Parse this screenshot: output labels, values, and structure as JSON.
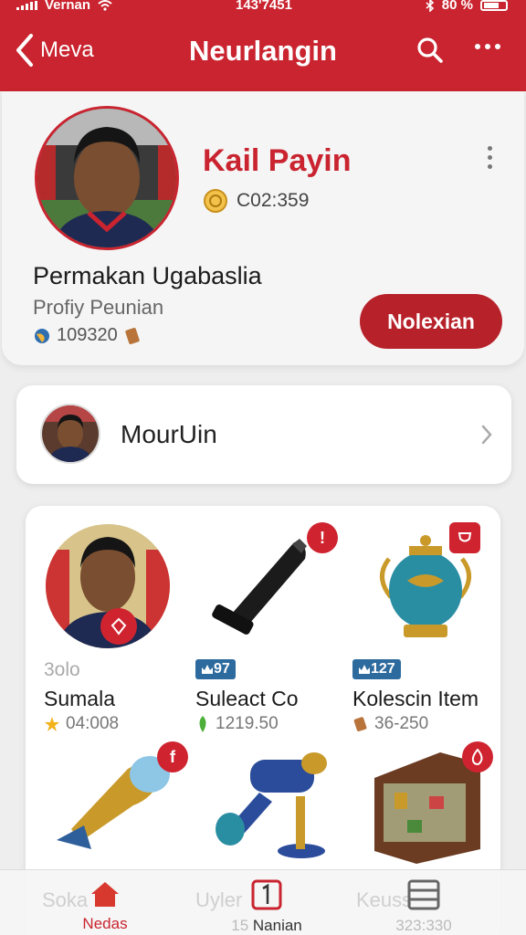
{
  "status_bar": {
    "carrier": "Vernan",
    "time": "143'7451",
    "battery": "80 %"
  },
  "header": {
    "back_label": "Meva",
    "title": "Neurlangin"
  },
  "profile": {
    "name": "Kail Payin",
    "coin_value": "C02:359",
    "heading": "Permakan Ugabaslia",
    "subtitle": "Profiy Peunian",
    "stat_value": "109320",
    "action_label": "Nolexian"
  },
  "contact": {
    "name": "MourUin"
  },
  "items": [
    {
      "small_label": "3olo",
      "title": "Sumala",
      "meta": "04:008"
    },
    {
      "tag": "97",
      "title": "Suleact Co",
      "meta": "1219.50",
      "badge": "!"
    },
    {
      "tag": "127",
      "title": "Kolescin Item",
      "meta": "36-250"
    },
    {
      "tag": "",
      "title": "Soka",
      "badge": "f"
    },
    {
      "tag": "",
      "title": "Uyler",
      "meta": "15"
    },
    {
      "tag": "",
      "title": "Keuss",
      "meta": "323:330"
    }
  ],
  "bottom_nav": [
    {
      "label": "Nedas",
      "icon": "home-icon",
      "active": true
    },
    {
      "label": "Nanian",
      "icon": "one-square-icon",
      "active": false
    },
    {
      "label": "",
      "icon": "list-icon",
      "active": false
    }
  ],
  "colors": {
    "brand_red": "#c9242f",
    "tag_blue": "#2d6b9e"
  }
}
